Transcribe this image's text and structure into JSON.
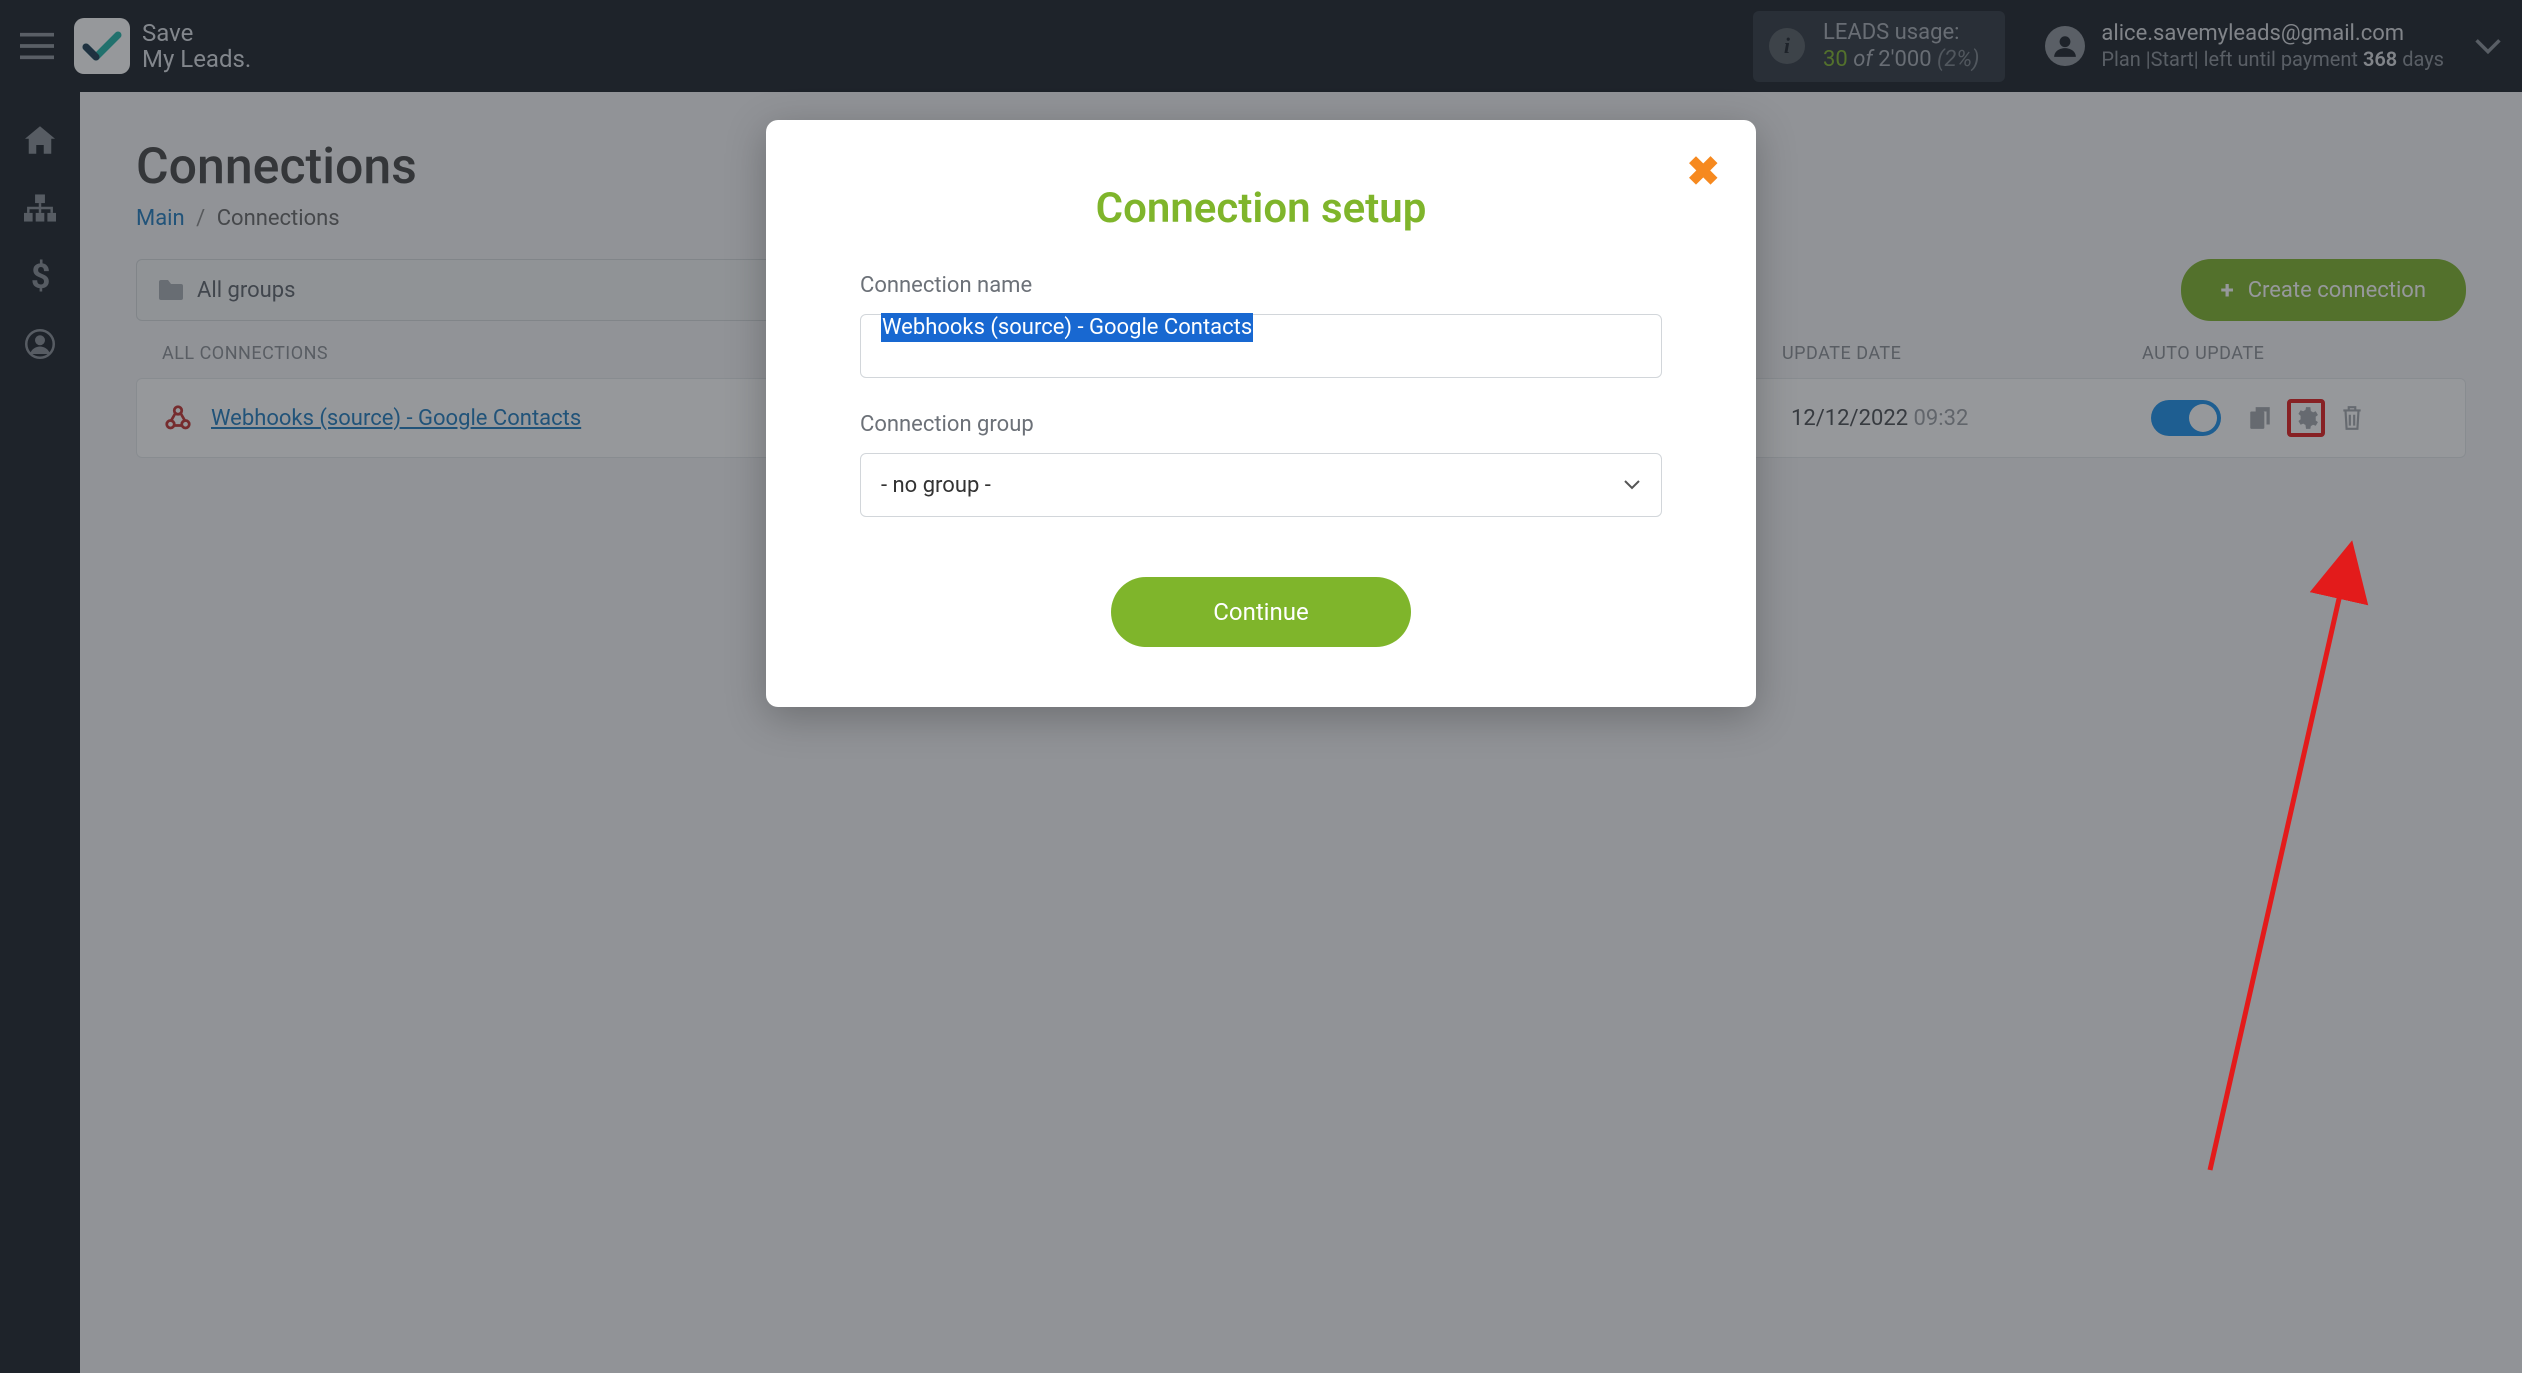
{
  "brand": {
    "line1": "Save",
    "line2": "My Leads."
  },
  "header": {
    "usage_label": "LEADS usage:",
    "usage_count": "30",
    "usage_of": "of",
    "usage_total": "2'000",
    "usage_pct": "(2%)",
    "user_email": "alice.savemyleads@gmail.com",
    "plan_prefix": "Plan |",
    "plan_name": "Start",
    "plan_mid": "| left until payment ",
    "plan_days": "368",
    "plan_suffix": " days"
  },
  "page": {
    "title": "Connections",
    "breadcrumb_main": "Main",
    "breadcrumb_current": "Connections"
  },
  "toolbar": {
    "group_filter": "All groups",
    "create_label": "Create connection"
  },
  "table": {
    "headers": {
      "name": "ALL CONNECTIONS",
      "date": "UPDATE DATE",
      "auto": "AUTO UPDATE"
    },
    "rows": [
      {
        "name": "Webhooks (source) - Google Contacts",
        "date": "12/12/2022",
        "time": "09:32",
        "auto_on": true
      }
    ]
  },
  "modal": {
    "title": "Connection setup",
    "name_label": "Connection name",
    "name_value": "Webhooks (source) - Google Contacts",
    "group_label": "Connection group",
    "group_value": "- no group -",
    "continue": "Continue"
  }
}
